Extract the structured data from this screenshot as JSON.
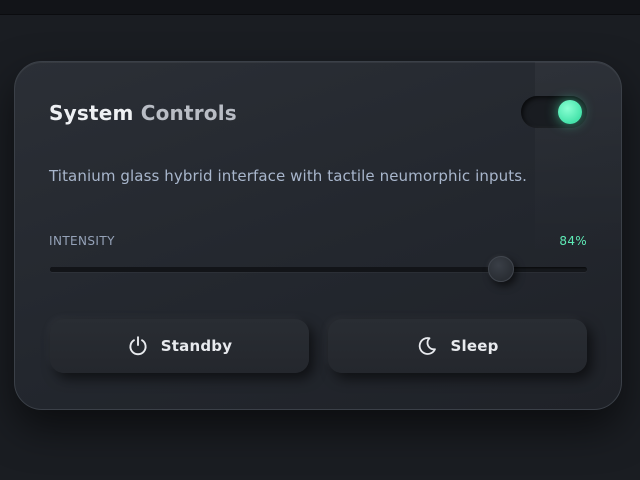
{
  "panel": {
    "title_primary": "System",
    "title_secondary": "Controls",
    "description": "Titanium glass hybrid interface with tactile neumorphic inputs."
  },
  "power_toggle": {
    "state": "on",
    "accent_color": "#5cf0bf"
  },
  "intensity": {
    "label": "INTENSITY",
    "value_text": "84%",
    "value": 0.84
  },
  "actions": {
    "standby": {
      "label": "Standby",
      "icon": "power-icon"
    },
    "sleep": {
      "label": "Sleep",
      "icon": "moon-icon"
    }
  },
  "colors": {
    "background": "#1a1d22",
    "card": "#262a30",
    "accent": "#5eeab6",
    "description_text": "#a8b6cc"
  }
}
